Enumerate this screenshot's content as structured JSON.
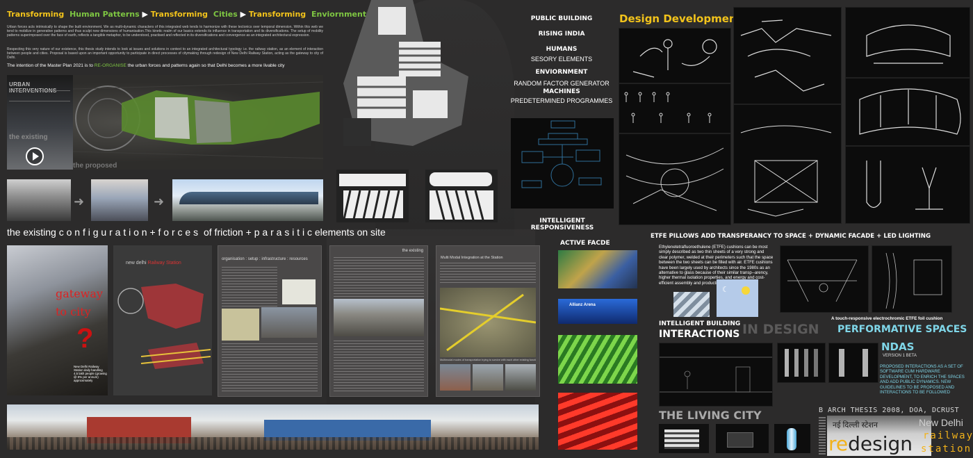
{
  "header": {
    "parts": [
      "Transforming",
      "Human Patterns",
      "Transforming",
      "Cities",
      "Transforming",
      "Enviornments"
    ],
    "intro_1": "Urban forces acts intrinsically to shape the built environment. We as multi-dynamic characters of this integrated web tends to harmonize with these tectonics over temporal dimension. Within this web we tend to mobilize in generative patterns and thus sculpt new dimensions of humanisation.This kinetic realm of our basics extends its influence in transportation and its diversifications. The setup of mobility patterns superimposed over the face of earth, reflects a tangible metaphor, to be understood, practised and reflected in its diversifications and convergence as an integrated architectural expression.",
    "intro_2": "Respecting this very nature of our existence, this thesis study intends to look at issues and solutions in context to an integrated architectural typology i.e. the railway station, as an element of interaction between people and cities. Proposal is based upon an important opportunity to participate in direct processes of citymaking through redesign of New Delhi Railway Station, acting as the gateway to city of Delhi.",
    "master_plan_a": "The intention of the Master Plan 2021 is to",
    "master_plan_b": "RE-ORGANISE",
    "master_plan_c": "the urban forces and patterns again so that Delhi becomes a more livable city"
  },
  "left_media": {
    "urban_title": "URBAN INTERVENTIONS",
    "the_existing": "the existing",
    "the_proposed": "the proposed"
  },
  "config_title": {
    "a": "the existing",
    "b": "c o n f i g u r a t i o n + f o r c e s",
    "c": "of friction +",
    "d": "p a r a s i t i c",
    "e": "elements on site"
  },
  "gateway": {
    "line1": "gateway",
    "line2": "to city",
    "q": "?",
    "note": "New Delhi Railway Station daily handling 4.5 lakh people (growing @ 8% per annum) approximately"
  },
  "map_panel": {
    "label_a": "new delhi",
    "label_b": "Railway Station"
  },
  "panel_org": {
    "title": "organisation : setup : infrastructure : resources"
  },
  "panel_existing": {
    "title": "the existing"
  },
  "panel_multimodal": {
    "title": "Multi Modal Integration at the Station",
    "caption": "Multimodal modes of transportation trying to survive with each other existing functionalities"
  },
  "center_labels": {
    "items": [
      "PUBLIC BUILDING",
      "RISING INDIA",
      "HUMANS",
      "SESORY ELEMENTS",
      "ENVIORNMENT",
      "RANDOM FACTOR GENERATOR",
      "MACHINES",
      "PREDETERMINED PROGRAMMES"
    ],
    "intelligent": "INTELLIGENT",
    "responsiveness": "RESPONSIVENESS"
  },
  "design_dev": {
    "title": "Design Development"
  },
  "active_facade": {
    "title": "ACTIVE FACDE",
    "allianz": "Allianz Arena"
  },
  "etfe": {
    "title": "ETFE PILLOWS ADD TRANSPERANCY TO SPACE + DYNAMIC FACADE + LED LIGHTING",
    "text": "Ethylenetetrafluoroethulene (ETFE) cushions can be most simply described as two thin sheets of a very strong and clear polymer, welded at their perimeters such that the space between the two sheets can be filled with air. ETFE cushions have been largely used by architects since the 1980s as an alternative to glass because of their similar transp--arency, higher thermal isolation properties, and energy and cost-efficient assembly and production processes",
    "cushion": "A touch-responsive electrochromic ETFE foil cushion"
  },
  "interactions": {
    "small_title": "INTELLIGENT BUILDING",
    "big_title": "INTERACTIONS",
    "in_design": "IN DESIGN",
    "performative": "PERFORMATIVE SPACES",
    "ndas": "NDAS",
    "version": "VERSION 1 BETA",
    "desc": "PROPOSED INTERACTIONS AS A SET OF SOFTWARE CUM HARDWARE DEVELOPMENT, TO ENRICH THE SPACES AND ADD PUBLIC DYNAMICS. NEW GUIDELINES TO BE PROPOSED AND INTERACTIONS TO BE FOLLOWED"
  },
  "living_city": {
    "title": "THE LIVING CITY"
  },
  "footer": {
    "thesis": "B ARCH THESIS 2008, DOA, DCRUST",
    "hindi": "नई दिल्ली स्टेशन",
    "re": "re",
    "design": "design",
    "new_delhi": "New Delhi",
    "railway": "railway",
    "station": "station"
  }
}
